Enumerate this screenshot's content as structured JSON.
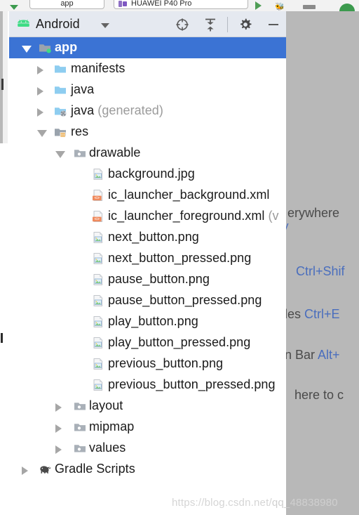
{
  "top_toolbar": {
    "app_chip_label": "app",
    "device_chip_label": "HUAWEI P40 Pro",
    "icons": {
      "dropdown_arrow": "chevron-down-icon",
      "device": "device-icon",
      "run": "run-icon",
      "debug": "debug-icon",
      "misc": "toolbar-button-icon",
      "avd": "avd-icon"
    }
  },
  "tool_window": {
    "title": "Android",
    "logo_icon": "android-robot-icon",
    "dropdown_icon": "chevron-down-icon",
    "buttons": [
      {
        "name": "select-opened-file-button",
        "icon": "crosshair-target-icon",
        "tooltip": "Select Opened File"
      },
      {
        "name": "collapse-all-button",
        "icon": "collapse-all-icon",
        "tooltip": "Collapse All"
      },
      {
        "name": "settings-button",
        "icon": "gear-icon",
        "tooltip": "Settings"
      },
      {
        "name": "hide-button",
        "icon": "minimize-icon",
        "tooltip": "Hide"
      }
    ]
  },
  "tree": {
    "nodes": [
      {
        "label": "app",
        "suffix": "",
        "indent": 0,
        "twisty": "open",
        "icon": "folder-module-icon",
        "selected": true
      },
      {
        "label": "manifests",
        "suffix": "",
        "indent": 1,
        "twisty": "closed",
        "icon": "folder-blue-icon",
        "selected": false
      },
      {
        "label": "java",
        "suffix": "",
        "indent": 1,
        "twisty": "closed",
        "icon": "folder-blue-icon",
        "selected": false
      },
      {
        "label": "java",
        "suffix": " (generated)",
        "indent": 1,
        "twisty": "closed",
        "icon": "folder-generated-icon",
        "selected": false
      },
      {
        "label": "res",
        "suffix": "",
        "indent": 1,
        "twisty": "open",
        "icon": "folder-res-icon",
        "selected": false
      },
      {
        "label": "drawable",
        "suffix": "",
        "indent": 2,
        "twisty": "open",
        "icon": "folder-grey-icon",
        "selected": false
      },
      {
        "label": "background.jpg",
        "suffix": "",
        "indent": 3,
        "twisty": "none",
        "icon": "image-file-icon",
        "selected": false
      },
      {
        "label": "ic_launcher_background.xml",
        "suffix": "",
        "indent": 3,
        "twisty": "none",
        "icon": "xml-file-icon",
        "selected": false
      },
      {
        "label": "ic_launcher_foreground.xml",
        "suffix": " (v",
        "indent": 3,
        "twisty": "none",
        "icon": "xml-file-icon",
        "selected": false
      },
      {
        "label": "next_button.png",
        "suffix": "",
        "indent": 3,
        "twisty": "none",
        "icon": "image-file-icon",
        "selected": false
      },
      {
        "label": "next_button_pressed.png",
        "suffix": "",
        "indent": 3,
        "twisty": "none",
        "icon": "image-file-icon",
        "selected": false
      },
      {
        "label": "pause_button.png",
        "suffix": "",
        "indent": 3,
        "twisty": "none",
        "icon": "image-file-icon",
        "selected": false
      },
      {
        "label": "pause_button_pressed.png",
        "suffix": "",
        "indent": 3,
        "twisty": "none",
        "icon": "image-file-icon",
        "selected": false
      },
      {
        "label": "play_button.png",
        "suffix": "",
        "indent": 3,
        "twisty": "none",
        "icon": "image-file-icon",
        "selected": false
      },
      {
        "label": "play_button_pressed.png",
        "suffix": "",
        "indent": 3,
        "twisty": "none",
        "icon": "image-file-icon",
        "selected": false
      },
      {
        "label": "previous_button.png",
        "suffix": "",
        "indent": 3,
        "twisty": "none",
        "icon": "image-file-icon",
        "selected": false
      },
      {
        "label": "previous_button_pressed.png",
        "suffix": "",
        "indent": 3,
        "twisty": "none",
        "icon": "image-file-icon",
        "selected": false
      },
      {
        "label": "layout",
        "suffix": "",
        "indent": 2,
        "twisty": "closed",
        "icon": "folder-grey-icon",
        "selected": false
      },
      {
        "label": "mipmap",
        "suffix": "",
        "indent": 2,
        "twisty": "closed",
        "icon": "folder-grey-icon",
        "selected": false
      },
      {
        "label": "values",
        "suffix": "",
        "indent": 2,
        "twisty": "closed",
        "icon": "folder-grey-icon",
        "selected": false
      },
      {
        "label": "Gradle Scripts",
        "suffix": "",
        "indent": 0,
        "twisty": "closed",
        "icon": "gradle-elephant-icon",
        "selected": false
      }
    ]
  },
  "tips_panel": {
    "lines": [
      {
        "text": "erywhere",
        "key": ""
      },
      {
        "text": "",
        "key": "Ctrl+Shif"
      },
      {
        "text": "les ",
        "key": "Ctrl+E"
      },
      {
        "text": "n Bar ",
        "key": "Alt+"
      },
      {
        "text": "here to c",
        "key": ""
      }
    ],
    "edge_fragment": "v"
  },
  "watermark": {
    "prefix": "https://blog.csdn.net/",
    "user": "qq_48838980"
  },
  "colors": {
    "selection_blue": "#3b73d4",
    "header_bg": "#e5e9f0",
    "panel_grey": "#b8b8b8",
    "folder_blue": "#8ecdf0",
    "folder_grey": "#a9b0b8",
    "xml_badge_orange": "#f08a5d",
    "android_green": "#3ddc84",
    "link_blue": "#4a6ebd"
  }
}
